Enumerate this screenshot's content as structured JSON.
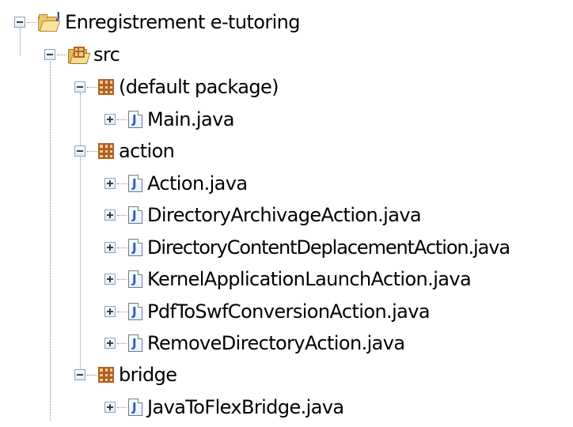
{
  "tree": {
    "project": {
      "label": "Enregistrement e-tutoring",
      "icon": "java-project-folder-icon",
      "expanded": true
    },
    "src": {
      "label": "src",
      "icon": "source-folder-icon",
      "expanded": true
    },
    "packages": [
      {
        "label": "(default package)",
        "icon": "package-icon",
        "expanded": true,
        "files": [
          "Main.java"
        ]
      },
      {
        "label": "action",
        "icon": "package-icon",
        "expanded": true,
        "files": [
          "Action.java",
          "DirectoryArchivageAction.java",
          "DirectoryContentDeplacementAction.java",
          "KernelApplicationLaunchAction.java",
          "PdfToSwfConversionAction.java",
          "RemoveDirectoryAction.java"
        ]
      },
      {
        "label": "bridge",
        "icon": "package-icon",
        "expanded": true,
        "files": [
          "JavaToFlexBridge.java"
        ]
      }
    ]
  },
  "colors": {
    "background": "#ffffff",
    "tree_line": "#8c8c8c",
    "package_icon": "#b05f1f",
    "java_icon_letter": "#2a5bb7"
  }
}
